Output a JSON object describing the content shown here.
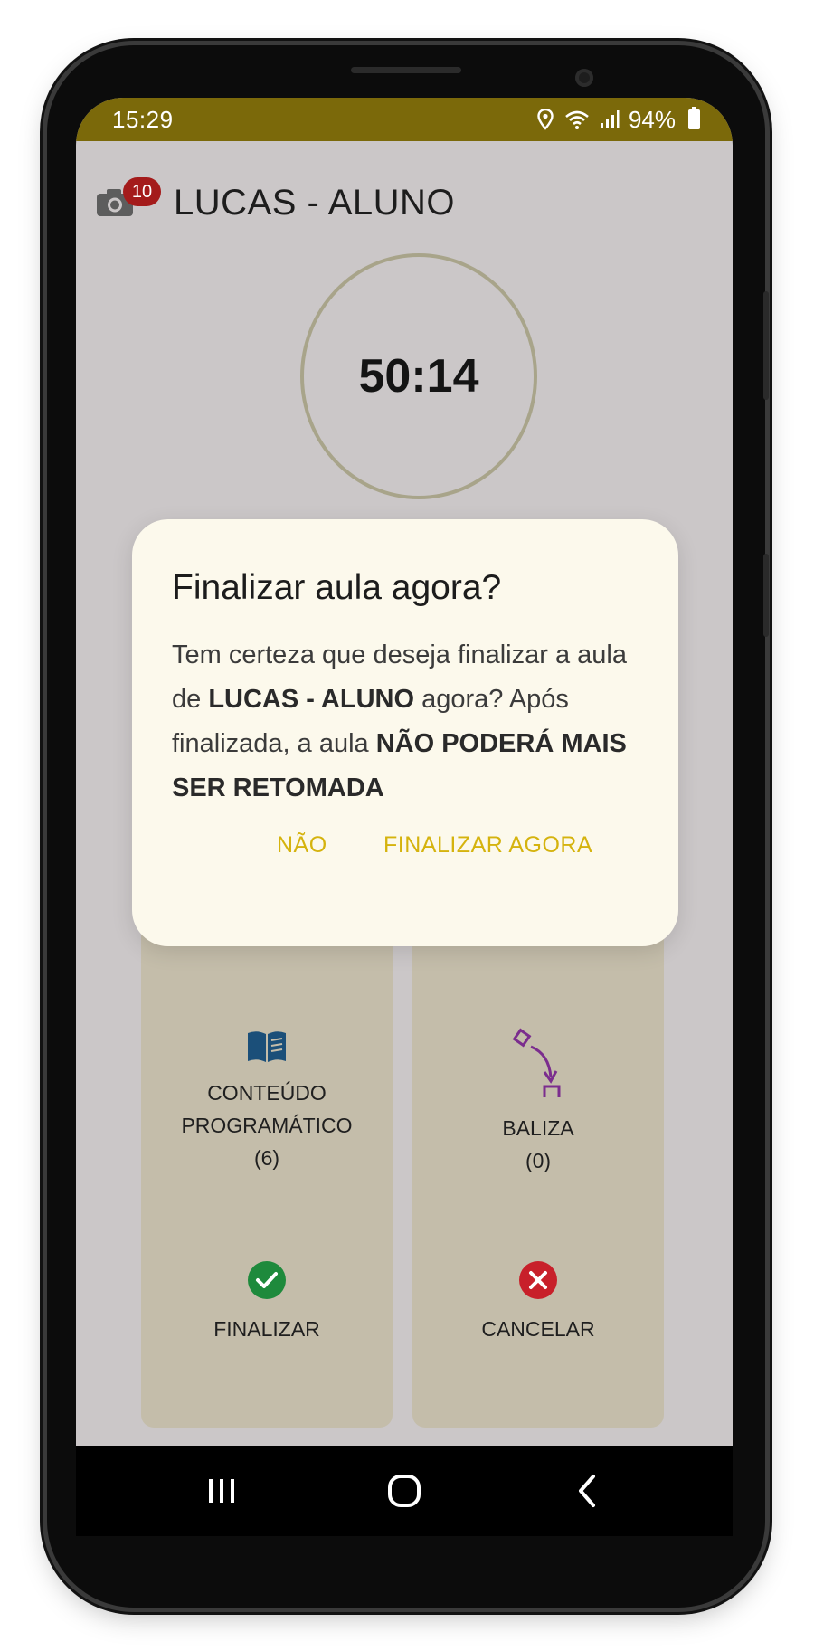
{
  "status_bar": {
    "time": "15:29",
    "battery": "94%",
    "icons": [
      "location-icon",
      "wifi-icon",
      "signal-icon",
      "battery-icon"
    ]
  },
  "app_bar": {
    "camera_badge_count": "10",
    "title": "LUCAS - ALUNO"
  },
  "timer": {
    "value": "50:14"
  },
  "dialog": {
    "title": "Finalizar aula agora?",
    "body_1": "Tem certeza que deseja finalizar a aula de ",
    "body_name": "LUCAS - ALUNO",
    "body_2": " agora? Após finalizada, a aula ",
    "body_bold": "NÃO PODERÁ MAIS SER RETOMADA",
    "cancel_label": "NÃO",
    "confirm_label": "FINALIZAR AGORA"
  },
  "tiles": {
    "conteudo": {
      "line1": "CONTEÚDO",
      "line2": "PROGRAMÁTICO",
      "count": "(6)",
      "icon": "book-icon"
    },
    "baliza": {
      "label": "BALIZA",
      "count": "(0)",
      "icon": "parking-maneuver-icon"
    },
    "finalizar": {
      "label": "FINALIZAR",
      "icon": "check-circle-icon"
    },
    "cancelar": {
      "label": "CANCELAR",
      "icon": "close-circle-icon"
    }
  },
  "colors": {
    "status_bar": "#7b690a",
    "dialog_button": "#d5b30e",
    "badge": "#a41b1b",
    "tile": "#c4bdaa",
    "check": "#1e8a3c",
    "cancel": "#c8202a",
    "baliza_icon": "#7b2d8e",
    "book_icon": "#1b4f79"
  }
}
